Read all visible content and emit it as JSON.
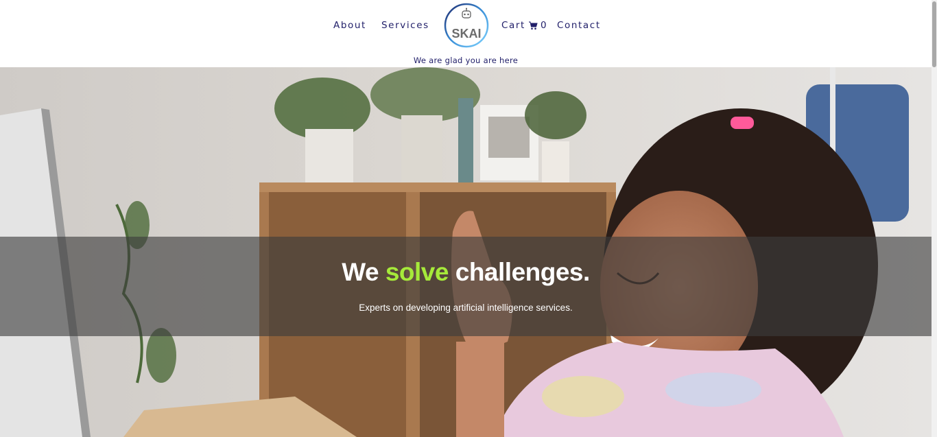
{
  "nav": {
    "about": "About",
    "services": "Services",
    "cart_label": "Cart",
    "cart_count": "0",
    "contact": "Contact"
  },
  "logo": {
    "text": "SKAI"
  },
  "tagline": "We are glad you are here",
  "hero": {
    "title_pre": "We ",
    "title_accent": "solve",
    "title_post": " challenges.",
    "subtitle": "Experts on developing artificial intelligence services."
  },
  "colors": {
    "nav_text": "#22206a",
    "accent_green": "#a6ea3a",
    "logo_ring": "#3a8fd8"
  },
  "icons": [
    "cart-icon",
    "robot-icon"
  ]
}
